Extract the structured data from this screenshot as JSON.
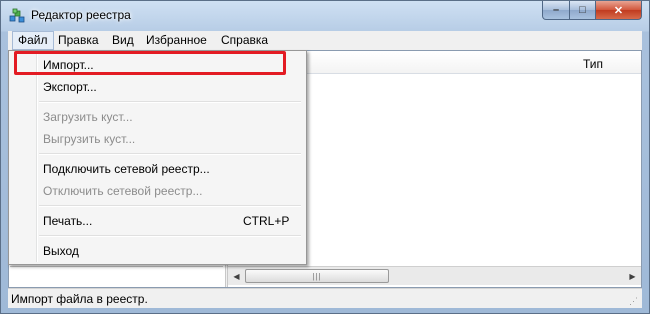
{
  "window": {
    "title": "Редактор реестра",
    "icon": "registry-editor-icon",
    "controls": {
      "minimize": "–",
      "maximize": "□",
      "close": "✕"
    }
  },
  "menubar": [
    "Файл",
    "Правка",
    "Вид",
    "Избранное",
    "Справка"
  ],
  "menu": {
    "items": [
      {
        "label": "Импорт...",
        "enabled": true,
        "highlighted": true
      },
      {
        "label": "Экспорт...",
        "enabled": true
      },
      {
        "label": "Загрузить куст...",
        "enabled": false
      },
      {
        "label": "Выгрузить куст...",
        "enabled": false
      },
      {
        "label": "Подключить сетевой реестр...",
        "enabled": true
      },
      {
        "label": "Отключить сетевой реестр...",
        "enabled": false
      },
      {
        "label": "Печать...",
        "enabled": true,
        "shortcut": "CTRL+P"
      },
      {
        "label": "Выход",
        "enabled": true
      }
    ]
  },
  "list": {
    "column_type": "Тип"
  },
  "status": "Импорт файла в реестр.",
  "colors": {
    "highlight": "#e31b23",
    "close_button": "#c8452a"
  }
}
